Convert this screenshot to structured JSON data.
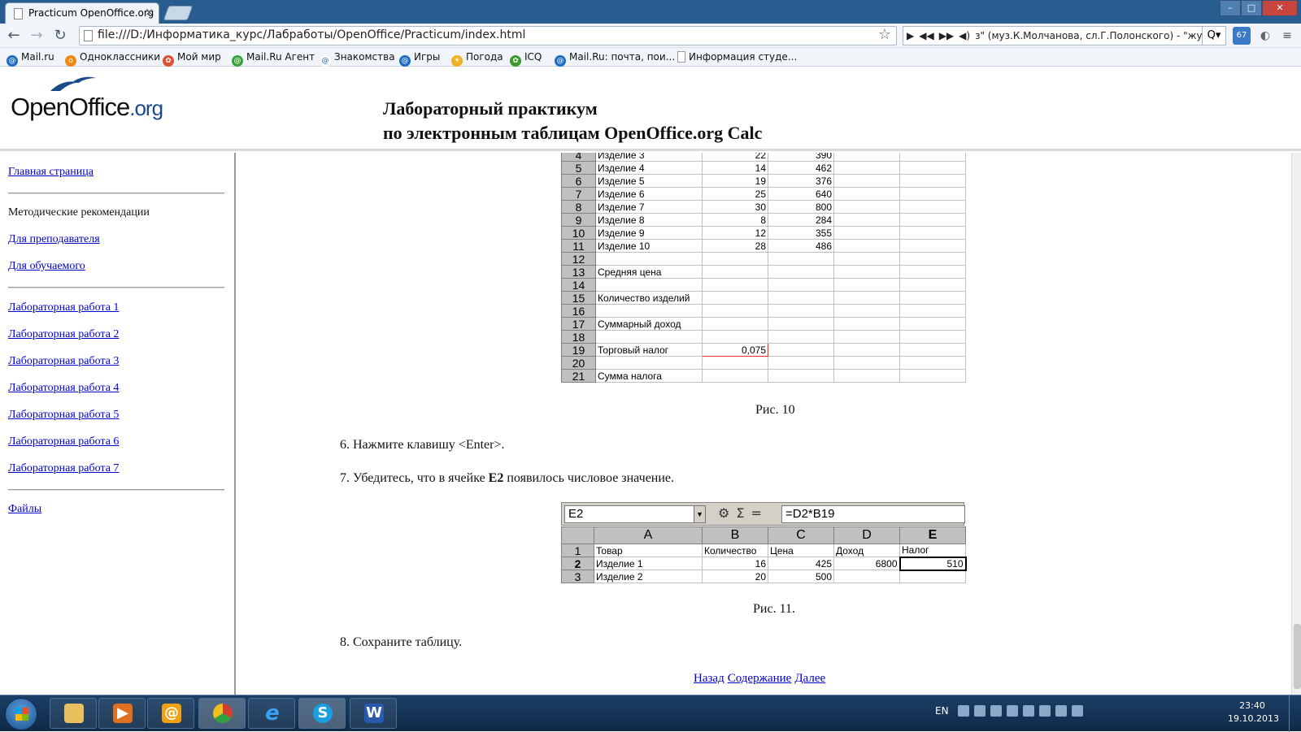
{
  "browser": {
    "tab_title": "Practicum OpenOffice.org",
    "tab_close": "×",
    "url": "file:///D:/Информатика_курс/Лабработы/OpenOffice/Practicum/index.html",
    "player_text": "з\" (муз.К.Молчанова, сл.Г.Полонского) - \"жу",
    "search_label": "Q▾",
    "ext_badge": "67",
    "bookmarks": [
      "Mail.ru",
      "Одноклассники",
      "Мой мир",
      "Mail.Ru Агент",
      "Знакомства",
      "Игры",
      "Погода",
      "ICQ",
      "Mail.Ru: почта, пои...",
      "Информация студе..."
    ]
  },
  "header": {
    "logo_main": "OpenOffice",
    "logo_suffix": ".org",
    "title_line1": "Лабораторный практикум",
    "title_line2": "по электронным таблицам OpenOffice.org Calc"
  },
  "sidebar": {
    "home": "Главная страница",
    "method_heading": "Методические рекомендации",
    "teacher": "Для преподавателя",
    "student": "Для обучаемого",
    "labs": [
      "Лабораторная работа 1",
      "Лабораторная работа 2",
      "Лабораторная работа 3",
      "Лабораторная работа 4",
      "Лабораторная работа 5",
      "Лабораторная работа 6",
      "Лабораторная работа 7"
    ],
    "files": "Файлы"
  },
  "sheet1": {
    "rows": [
      {
        "n": "4",
        "a": "Изделие 3",
        "b": "22",
        "c": "390"
      },
      {
        "n": "5",
        "a": "Изделие 4",
        "b": "14",
        "c": "462"
      },
      {
        "n": "6",
        "a": "Изделие 5",
        "b": "19",
        "c": "376"
      },
      {
        "n": "7",
        "a": "Изделие 6",
        "b": "25",
        "c": "640"
      },
      {
        "n": "8",
        "a": "Изделие 7",
        "b": "30",
        "c": "800"
      },
      {
        "n": "9",
        "a": "Изделие 8",
        "b": "8",
        "c": "284"
      },
      {
        "n": "10",
        "a": "Изделие 9",
        "b": "12",
        "c": "355"
      },
      {
        "n": "11",
        "a": "Изделие 10",
        "b": "28",
        "c": "486"
      },
      {
        "n": "12",
        "a": "",
        "b": "",
        "c": ""
      },
      {
        "n": "13",
        "a": "Средняя цена",
        "b": "",
        "c": ""
      },
      {
        "n": "14",
        "a": "",
        "b": "",
        "c": ""
      },
      {
        "n": "15",
        "a": "Количество изделий",
        "b": "",
        "c": ""
      },
      {
        "n": "16",
        "a": "",
        "b": "",
        "c": ""
      },
      {
        "n": "17",
        "a": "Суммарный доход",
        "b": "",
        "c": ""
      },
      {
        "n": "18",
        "a": "",
        "b": "",
        "c": ""
      },
      {
        "n": "19",
        "a": "Торговый налог",
        "b": "0,075",
        "c": ""
      },
      {
        "n": "20",
        "a": "",
        "b": "",
        "c": ""
      },
      {
        "n": "21",
        "a": "Сумма налога",
        "b": "",
        "c": ""
      }
    ],
    "caption": "Рис. 10"
  },
  "steps": {
    "step6": "6.  Нажмите клавишу <Enter>.",
    "step7_pre": "7.  Убедитесь, что в ячейке ",
    "step7_bold": "E2",
    "step7_post": " появилось числовое значение.",
    "step8": "8.  Сохраните таблицу."
  },
  "sheet2": {
    "namebox": "E2",
    "formula": "=D2*B19",
    "fx_icons": "⚙Σ=",
    "columns": [
      "A",
      "B",
      "C",
      "D",
      "E"
    ],
    "rows": [
      {
        "n": "1",
        "cells": [
          "Товар",
          "Количество",
          "Цена",
          "Доход",
          "Налог"
        ]
      },
      {
        "n": "2",
        "cells": [
          "Изделие 1",
          "16",
          "425",
          "6800",
          "510"
        ]
      },
      {
        "n": "3",
        "cells": [
          "Изделие 2",
          "20",
          "500",
          "",
          ""
        ]
      }
    ],
    "caption": "Рис. 11."
  },
  "nav": {
    "back": "Назад",
    "contents": "Содержание",
    "next": "Далее"
  },
  "taskbar": {
    "lang": "EN",
    "time": "23:40",
    "date": "19.10.2013"
  }
}
